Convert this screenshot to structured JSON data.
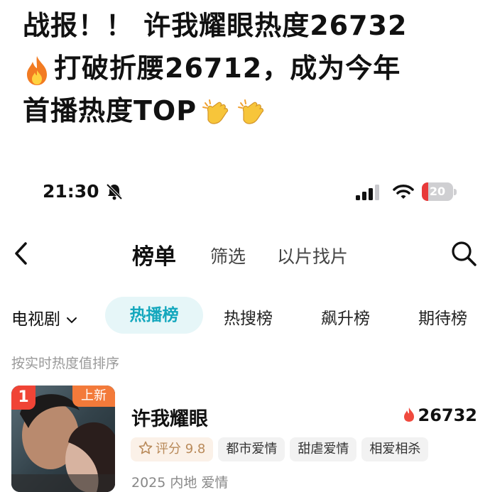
{
  "headline": {
    "line1": "战报！！ 许我耀眼热度26732",
    "line2_text": "打破折腰26712，成为今年",
    "line3_text": "首播热度TOP",
    "fire_emoji": "fire-emoji",
    "clap_emoji": "clapping-hands-emoji"
  },
  "status_bar": {
    "time": "21:30",
    "battery": "20",
    "battery_level": 0.2,
    "battery_color": "#e83a3a",
    "icons": [
      "bell-slash-icon",
      "signal-icon",
      "wifi-icon",
      "battery-icon"
    ]
  },
  "nav": {
    "back_icon": "chevron-left-icon",
    "tabs": [
      "榜单",
      "筛选",
      "以片找片"
    ],
    "search_icon": "search-icon"
  },
  "category": {
    "selected": "电视剧",
    "tabs": [
      "热播榜",
      "热搜榜",
      "飙升榜",
      "期待榜"
    ],
    "accent": "#13a7bd",
    "accent_bg": "#e6f6f8"
  },
  "hint": "按实时热度值排序",
  "list": [
    {
      "rank": "1",
      "badge": "上新",
      "title": "许我耀眼",
      "heat": "26732",
      "score_label": "评分 9.8",
      "tags": [
        "都市爱情",
        "甜虐爱情",
        "相爱相杀"
      ],
      "meta": "2025 内地 爱情",
      "rank_color": "#f04436",
      "badge_color": "#f37a3a"
    }
  ]
}
